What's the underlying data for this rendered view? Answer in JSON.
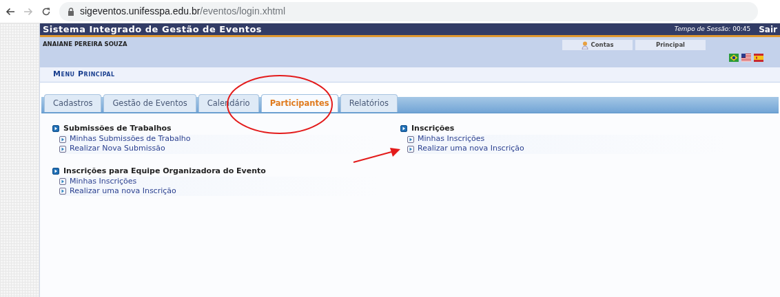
{
  "browser": {
    "url_host": "sigeventos.unifesspa.edu.br",
    "url_path": "/eventos/login.xhtml"
  },
  "header": {
    "title": "Sistema Integrado de Gestão de Eventos",
    "session_label": "Tempo de Sessão:",
    "session_time": "00:45",
    "logout": "Sair"
  },
  "user": {
    "name": "ANAIANE PEREIRA SOUZA",
    "links": [
      "Contas",
      "Principal"
    ]
  },
  "menu_title": "Menu Principal",
  "tabs": [
    {
      "label": "Cadastros",
      "selected": false
    },
    {
      "label": "Gestão de Eventos",
      "selected": false
    },
    {
      "label": "Calendário",
      "selected": false
    },
    {
      "label": "Participantes",
      "selected": true
    },
    {
      "label": "Relatórios",
      "selected": false
    }
  ],
  "columns": [
    [
      {
        "title": "Submissões de Trabalhos",
        "items": [
          "Minhas Submissões de Trabalho",
          "Realizar Nova Submissão"
        ]
      },
      {
        "title": "Inscrições para Equipe Organizadora do Evento",
        "items": [
          "Minhas Inscrições",
          "Realizar uma nova Inscrição"
        ]
      }
    ],
    [
      {
        "title": "Inscrições",
        "items": [
          "Minhas Inscrições",
          "Realizar uma nova Inscrição"
        ]
      }
    ]
  ]
}
